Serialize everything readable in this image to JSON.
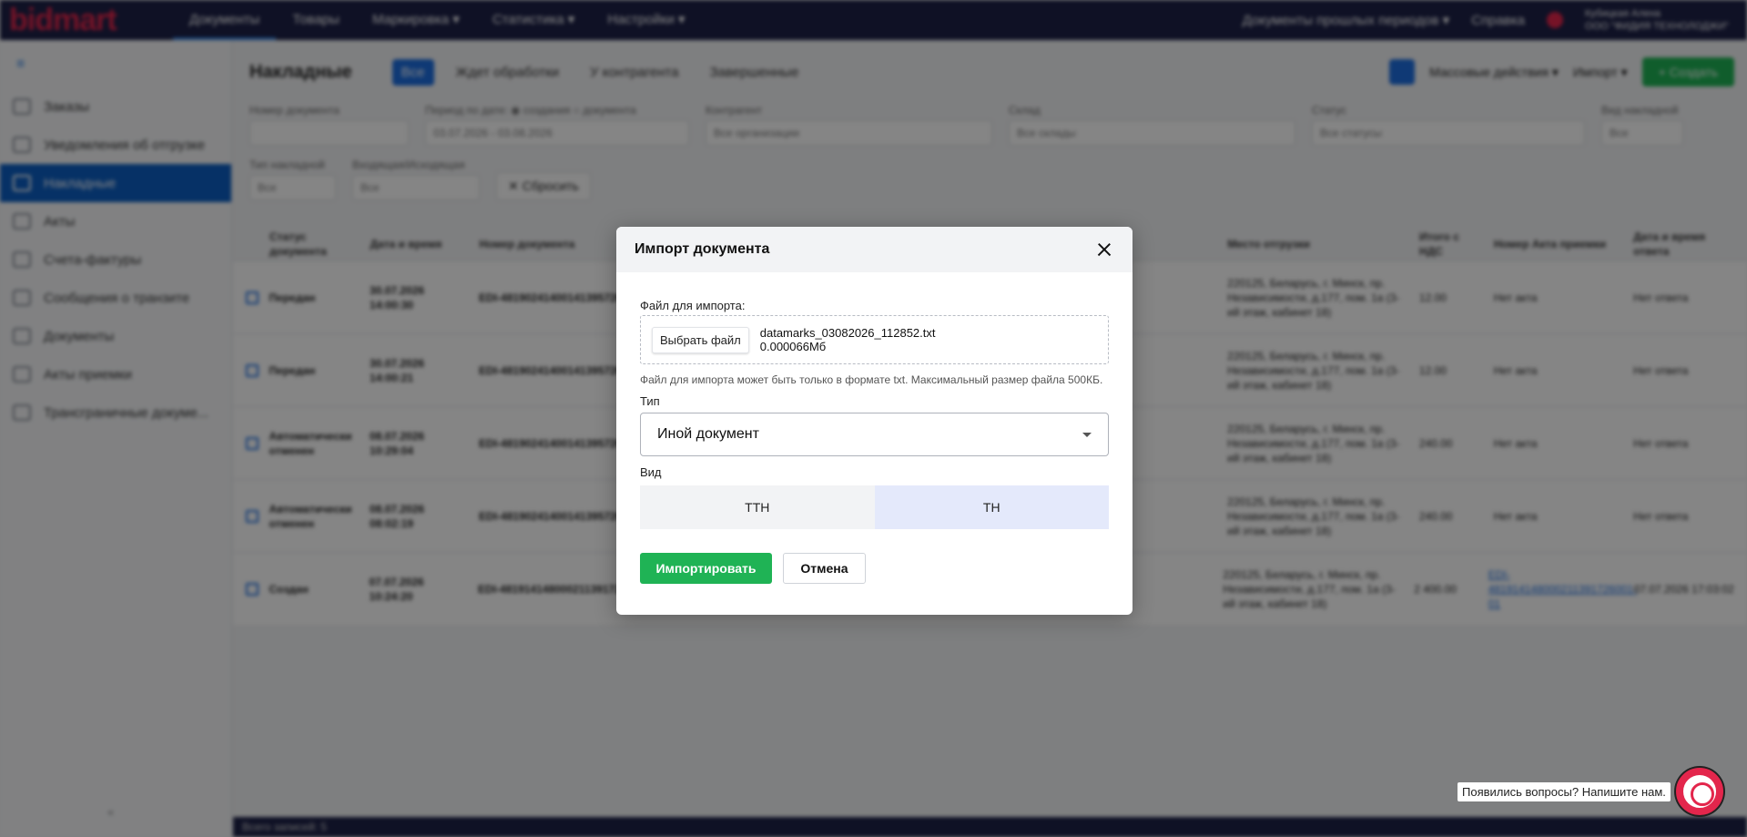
{
  "app": {
    "logo": "bidmart",
    "top_nav": [
      "Документы",
      "Товары",
      "Маркировка ▾",
      "Статистика ▾",
      "Настройки ▾"
    ],
    "top_right": {
      "periods": "Документы прошлых периодов ▾",
      "help": "Справка",
      "user_name": "Кубицкая Алена",
      "company": "ООО \"ФИДИЯ ТЕХНОЛОДЖИ\""
    },
    "sidebar": [
      "Заказы",
      "Уведомления об отгрузке",
      "Накладные",
      "Акты",
      "Счета-фактуры",
      "Сообщения о транзите",
      "Документы",
      "Акты приемки",
      "Трансграничные докуме..."
    ],
    "page_title": "Накладные",
    "tabs": [
      "Все",
      "Ждет обработки",
      "У контрагента",
      "Завершенные"
    ],
    "head_actions": {
      "mass": "Массовые действия ▾",
      "import": "Импорт ▾",
      "create": "+ Создать"
    },
    "filters": [
      {
        "label": "Номер документа",
        "value": ""
      },
      {
        "label": "Период по дате: ◉ создания ○ документа",
        "value": "03.07.2026 - 03.08.2026"
      },
      {
        "label": "Контрагент",
        "value": "Все организации"
      },
      {
        "label": "Склад",
        "value": "Все склады"
      },
      {
        "label": "Статус",
        "value": "Все статусы"
      },
      {
        "label": "Вид накладной",
        "value": "Все"
      },
      {
        "label": "Тип накладной",
        "value": "Все"
      },
      {
        "label": "Входящая/Исходящая",
        "value": "Все"
      }
    ],
    "reset": "✕ Сбросить",
    "table_headers": [
      "Статус документа",
      "Дата и время",
      "Номер документа",
      "Место отгрузки",
      "Итого с НДС",
      "Номер Акта приемки",
      "Дата и время ответа"
    ],
    "rows": [
      {
        "status": "Передан",
        "date": "30.07.2026 14:00:30",
        "number": "EDI-481902414001413957260006",
        "place": "220125, Беларусь, г. Минск, пр. Независимости, д.177, пом. 1а (3-ий этаж, кабинет 18)",
        "total": "12.00",
        "act": "Нет акта",
        "answer": "Нет ответа"
      },
      {
        "status": "Передан",
        "date": "30.07.2026 14:00:21",
        "number": "EDI-481902414001413957260004",
        "place": "220125, Беларусь, г. Минск, пр. Независимости, д.177, пом. 1а (3-ий этаж, кабинет 18)",
        "total": "12.00",
        "act": "Нет акта",
        "answer": "Нет ответа"
      },
      {
        "status": "Автоматически отменен",
        "date": "08.07.2026 10:29:04",
        "number": "EDI-481902414001413957260001",
        "place": "220125, Беларусь, г. Минск, пр. Независимости, д.177, пом. 1а (3-ий этаж, кабинет 18)",
        "total": "240.00",
        "act": "Нет акта",
        "answer": "Нет ответа"
      },
      {
        "status": "Автоматически отменен",
        "date": "08.07.2026 08:02:19",
        "number": "EDI-481902414001413957260009",
        "place": "220125, Беларусь, г. Минск, пр. Независимости, д.177, пом. 1а (3-ий этаж, кабинет 18)",
        "total": "240.00",
        "act": "Нет акта",
        "answer": "Нет ответа"
      },
      {
        "status": "Создан",
        "date": "07.07.2026 10:24:20",
        "number": "EDI-481914148000211391726001",
        "place": "220125, Беларусь, г. Минск, пр. Независимости, д.177, пом. 1а (3-ий этаж, кабинет 18)",
        "total": "2 400.00",
        "act": "EDI-481914148000211391726001-01",
        "answer": "07.07.2026 17:03:02"
      }
    ],
    "footer": "Всего записей: 5"
  },
  "modal": {
    "title": "Импорт документа",
    "file_label": "Файл для импорта:",
    "file_button": "Выбрать файл",
    "file_name": "datamarks_03082026_112852.txt",
    "file_size": "0.000066Мб",
    "hint": "Файл для импорта может быть только в формате txt. Максимальный размер файла 500КБ.",
    "type_label": "Тип",
    "type_value": "Иной документ",
    "kind_label": "Вид",
    "kind_options": [
      "ТТН",
      "ТН"
    ],
    "kind_selected": "ТН",
    "import_button": "Импортировать",
    "cancel_button": "Отмена"
  },
  "support": {
    "text": "Появились вопросы? Напишите нам."
  },
  "colors": {
    "header": "#1d2147",
    "brand": "#e3264c",
    "primary": "#1d6ee0",
    "success": "#1fb355"
  }
}
